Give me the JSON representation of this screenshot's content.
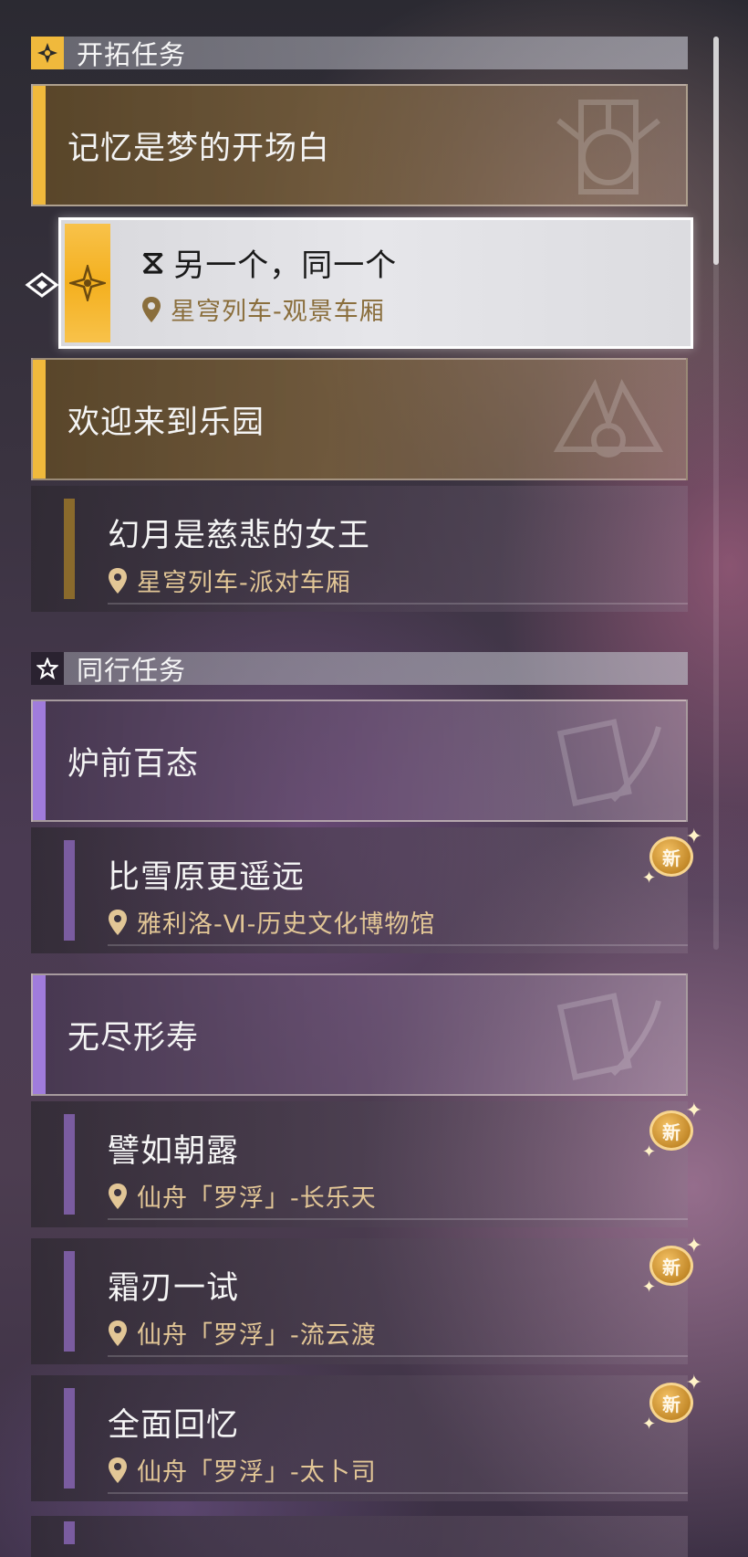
{
  "sections": {
    "trailblaze": {
      "title": "开拓任务",
      "icon": "trailblaze-diamond-icon",
      "accent": "#f0b93c"
    },
    "companion": {
      "title": "同行任务",
      "icon": "star-icon",
      "accent": "#a07cdc"
    }
  },
  "trailblaze_quests": [
    {
      "title": "记忆是梦的开场白",
      "subs": [
        {
          "title": "另一个，同一个",
          "location": "星穹列车-观景车厢",
          "selected": true,
          "tracking_icon": "hourglass-icon"
        }
      ]
    },
    {
      "title": "欢迎来到乐园",
      "subs": [
        {
          "title": "幻月是慈悲的女王",
          "location": "星穹列车-派对车厢"
        }
      ]
    }
  ],
  "companion_quests": [
    {
      "title": "炉前百态",
      "subs": [
        {
          "title": "比雪原更遥远",
          "location": "雅利洛-Ⅵ-历史文化博物馆",
          "badge": "新"
        }
      ]
    },
    {
      "title": "无尽形寿",
      "subs": [
        {
          "title": "譬如朝露",
          "location": "仙舟「罗浮」-长乐天",
          "badge": "新"
        },
        {
          "title": "霜刃一试",
          "location": "仙舟「罗浮」-流云渡",
          "badge": "新"
        },
        {
          "title": "全面回忆",
          "location": "仙舟「罗浮」-太卜司",
          "badge": "新"
        }
      ]
    }
  ],
  "colors": {
    "gold": "#f0b93c",
    "purple": "#a07cdc",
    "location_text": "#e2c696"
  }
}
